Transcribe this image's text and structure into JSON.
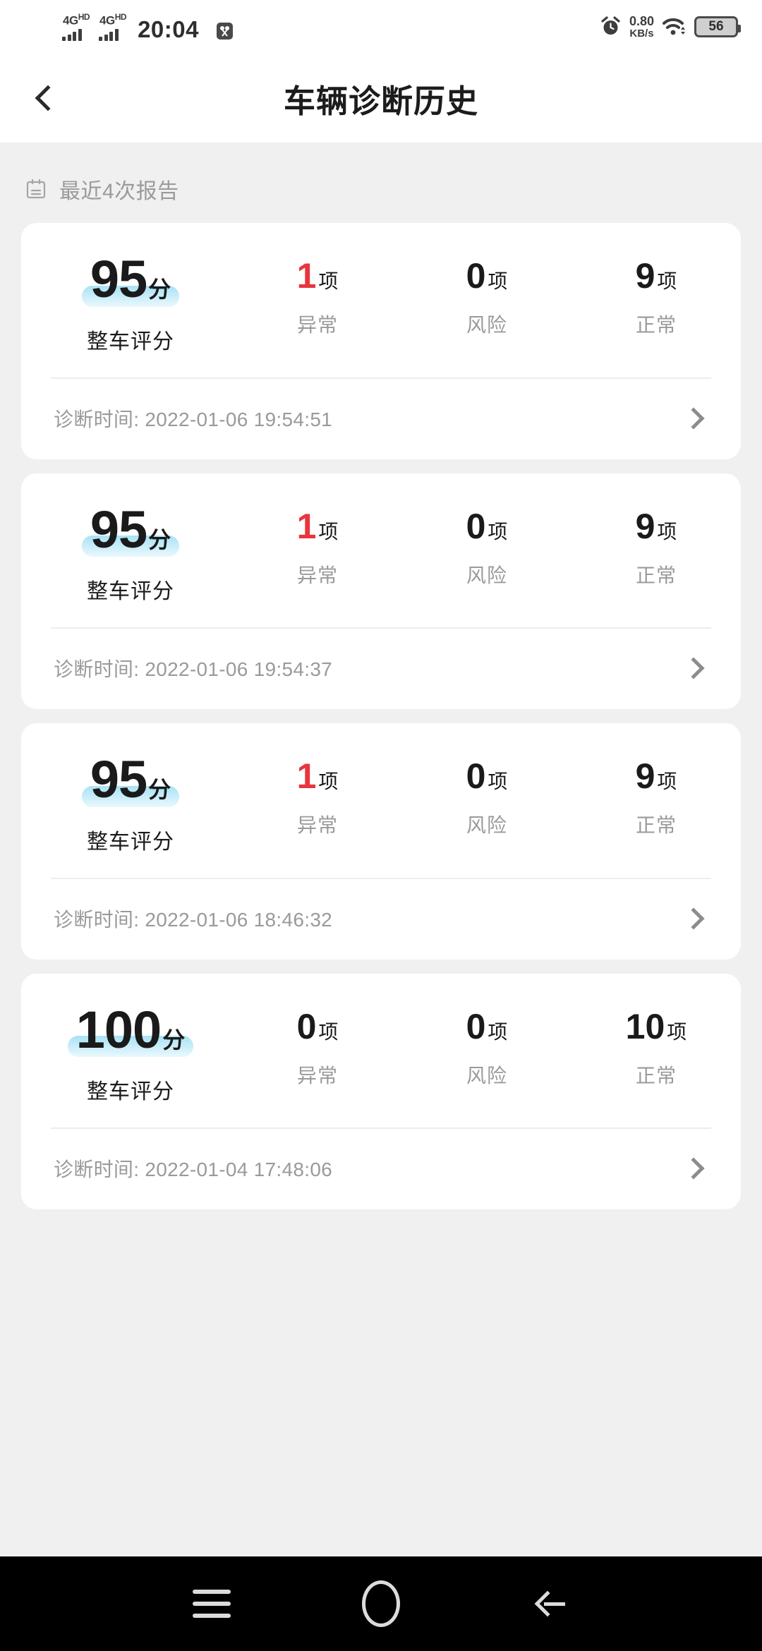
{
  "status_bar": {
    "sim1_network": "4G",
    "sim1_hd": "HD",
    "sim2_network": "4G",
    "sim2_hd": "HD",
    "time": "20:04",
    "screenshot_icon": "scissors-icon",
    "alarm_icon": "alarm-clock-icon",
    "net_speed_value": "0.80",
    "net_speed_unit": "KB/s",
    "wifi_icon": "wifi-icon",
    "battery_percent": "56"
  },
  "header": {
    "back_icon": "chevron-left-icon",
    "title": "车辆诊断历史"
  },
  "section": {
    "icon": "calendar-report-icon",
    "label": "最近4次报告"
  },
  "labels": {
    "score_caption": "整车评分",
    "score_unit": "分",
    "item_unit": "项",
    "abnormal": "异常",
    "risk": "风险",
    "normal": "正常",
    "time_prefix": "诊断时间: ",
    "row_chevron_icon": "chevron-right-icon"
  },
  "colors": {
    "page_bg": "#f0f0f0",
    "card_bg": "#ffffff",
    "danger": "#e8353e",
    "muted_text": "#9a9a9a",
    "primary_text": "#1a1a1a",
    "score_highlight": "#a8e2f5"
  },
  "reports": [
    {
      "score": "95",
      "abnormal_count": "1",
      "risk_count": "0",
      "normal_count": "9",
      "timestamp": "2022-01-06 19:54:51"
    },
    {
      "score": "95",
      "abnormal_count": "1",
      "risk_count": "0",
      "normal_count": "9",
      "timestamp": "2022-01-06 19:54:37"
    },
    {
      "score": "95",
      "abnormal_count": "1",
      "risk_count": "0",
      "normal_count": "9",
      "timestamp": "2022-01-06 18:46:32"
    },
    {
      "score": "100",
      "abnormal_count": "0",
      "risk_count": "0",
      "normal_count": "10",
      "timestamp": "2022-01-04 17:48:06"
    }
  ],
  "nav_bar": {
    "recents_icon": "menu-icon",
    "home_icon": "home-circle-icon",
    "back_icon": "back-arrow-icon"
  }
}
